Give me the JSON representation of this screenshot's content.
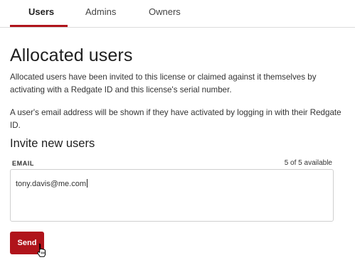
{
  "tabs": [
    {
      "label": "Users",
      "active": true
    },
    {
      "label": "Admins",
      "active": false
    },
    {
      "label": "Owners",
      "active": false
    }
  ],
  "page": {
    "title": "Allocated users",
    "description_1": "Allocated users have been invited to this license or claimed against it themselves by activating with a Redgate ID and this license's serial number.",
    "description_2": "A user's email address will be shown if they have activated by logging in with their Redgate ID."
  },
  "invite": {
    "title": "Invite new users",
    "email_label": "EMAIL",
    "availability": "5 of 5 available",
    "email_value": "tony.davis@me.com",
    "send_label": "Send"
  },
  "colors": {
    "accent": "#b0141b"
  },
  "icons": {
    "pointer": "hand-pointer-icon"
  }
}
